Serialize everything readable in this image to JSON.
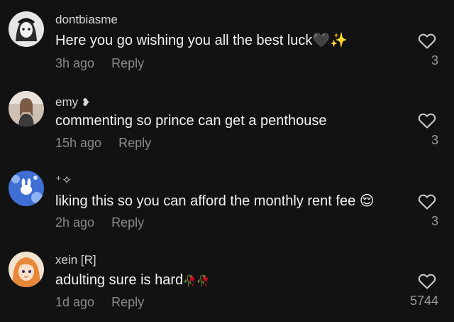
{
  "comments": [
    {
      "username": "dontbiasme",
      "text": "Here you go wishing you all the best luck",
      "emoji": "🖤✨",
      "time": "3h ago",
      "reply_label": "Reply",
      "likes": "3",
      "avatar_icon": "anime-girl-avatar"
    },
    {
      "username": "emy",
      "username_emoji": "❥",
      "text": "commenting so prince can get a penthouse",
      "emoji": "",
      "time": "15h ago",
      "reply_label": "Reply",
      "likes": "3",
      "avatar_icon": "photo-avatar"
    },
    {
      "username": "⁺✧",
      "text": "liking this so you can afford the monthly rent fee",
      "emoji": "😌",
      "time": "2h ago",
      "reply_label": "Reply",
      "likes": "3",
      "avatar_icon": "blue-sky-avatar"
    },
    {
      "username": "xein [R]",
      "text": "adulting sure is hard",
      "emoji": "🥀🥀",
      "time": "1d ago",
      "reply_label": "Reply",
      "likes": "5744",
      "avatar_icon": "anime-orange-hair-avatar"
    }
  ],
  "colors": {
    "background": "#121212",
    "meta_text": "#8a8a8a",
    "username_text": "#d8d8d8"
  }
}
